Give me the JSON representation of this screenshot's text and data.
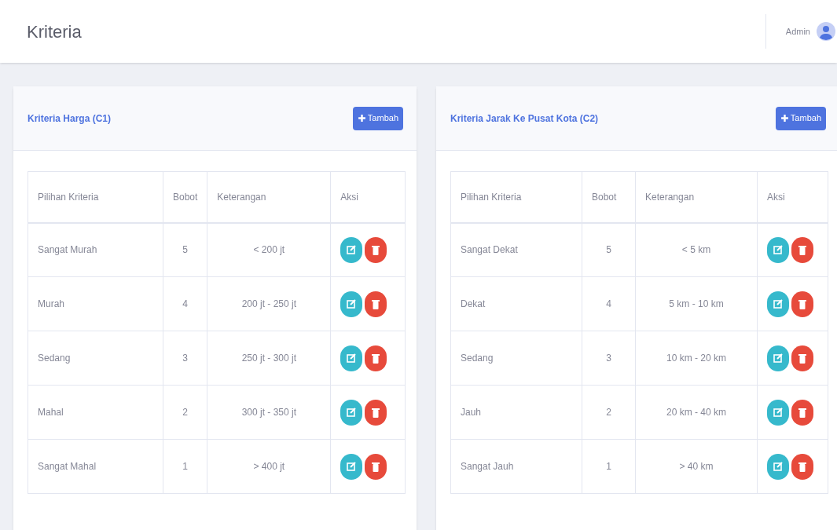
{
  "page_title": "Kriteria",
  "user": {
    "name": "Admin"
  },
  "cards": [
    {
      "title": "Kriteria Harga (C1)",
      "add_button": "Tambah",
      "columns": [
        "Pilihan Kriteria",
        "Bobot",
        "Keterangan",
        "Aksi"
      ],
      "rows": [
        {
          "option": "Sangat Murah",
          "weight": "5",
          "description": "< 200 jt"
        },
        {
          "option": "Murah",
          "weight": "4",
          "description": "200 jt - 250 jt"
        },
        {
          "option": "Sedang",
          "weight": "3",
          "description": "250 jt - 300 jt"
        },
        {
          "option": "Mahal",
          "weight": "2",
          "description": "300 jt - 350 jt"
        },
        {
          "option": "Sangat Mahal",
          "weight": "1",
          "description": "> 400 jt"
        }
      ]
    },
    {
      "title": "Kriteria Jarak Ke Pusat Kota (C2)",
      "add_button": "Tambah",
      "columns": [
        "Pilihan Kriteria",
        "Bobot",
        "Keterangan",
        "Aksi"
      ],
      "rows": [
        {
          "option": "Sangat Dekat",
          "weight": "5",
          "description": "< 5 km"
        },
        {
          "option": "Dekat",
          "weight": "4",
          "description": "5 km - 10 km"
        },
        {
          "option": "Sedang",
          "weight": "3",
          "description": "10 km - 20 km"
        },
        {
          "option": "Jauh",
          "weight": "2",
          "description": "20 km - 40 km"
        },
        {
          "option": "Sangat Jauh",
          "weight": "1",
          "description": "> 40 km"
        }
      ]
    }
  ]
}
